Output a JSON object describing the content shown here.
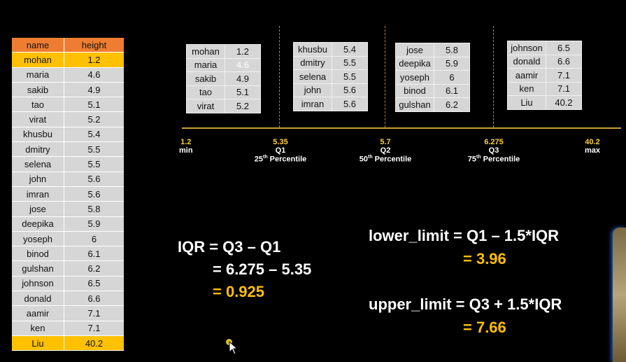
{
  "main_table": {
    "headers": [
      "name",
      "height"
    ],
    "rows": [
      [
        "mohan",
        "1.2"
      ],
      [
        "maria",
        "4.6"
      ],
      [
        "sakib",
        "4.9"
      ],
      [
        "tao",
        "5.1"
      ],
      [
        "virat",
        "5.2"
      ],
      [
        "khusbu",
        "5.4"
      ],
      [
        "dmitry",
        "5.5"
      ],
      [
        "selena",
        "5.5"
      ],
      [
        "john",
        "5.6"
      ],
      [
        "imran",
        "5.6"
      ],
      [
        "jose",
        "5.8"
      ],
      [
        "deepika",
        "5.9"
      ],
      [
        "yoseph",
        "6"
      ],
      [
        "binod",
        "6.1"
      ],
      [
        "gulshan",
        "6.2"
      ],
      [
        "johnson",
        "6.5"
      ],
      [
        "donald",
        "6.6"
      ],
      [
        "aamir",
        "7.1"
      ],
      [
        "ken",
        "7.1"
      ],
      [
        "Liu",
        "40.2"
      ]
    ]
  },
  "groups": [
    [
      [
        "mohan",
        "1.2"
      ],
      [
        "maria",
        "4.6"
      ],
      [
        "sakib",
        "4.9"
      ],
      [
        "tao",
        "5.1"
      ],
      [
        "virat",
        "5.2"
      ]
    ],
    [
      [
        "khusbu",
        "5.4"
      ],
      [
        "dmitry",
        "5.5"
      ],
      [
        "selena",
        "5.5"
      ],
      [
        "john",
        "5.6"
      ],
      [
        "imran",
        "5.6"
      ]
    ],
    [
      [
        "jose",
        "5.8"
      ],
      [
        "deepika",
        "5.9"
      ],
      [
        "yoseph",
        "6"
      ],
      [
        "binod",
        "6.1"
      ],
      [
        "gulshan",
        "6.2"
      ]
    ],
    [
      [
        "johnson",
        "6.5"
      ],
      [
        "donald",
        "6.6"
      ],
      [
        "aamir",
        "7.1"
      ],
      [
        "ken",
        "7.1"
      ],
      [
        "Liu",
        "40.2"
      ]
    ]
  ],
  "axis": {
    "min": {
      "value": "1.2",
      "label": "min"
    },
    "q1": {
      "value": "5.35",
      "label": "Q1",
      "pct_num": "25",
      "pct_sup": "th",
      "pct_text": " Percentile"
    },
    "q2": {
      "value": "5.7",
      "label": "Q2",
      "pct_num": "50",
      "pct_sup": "th",
      "pct_text": " Percentile"
    },
    "q3": {
      "value": "6.275",
      "label": "Q3",
      "pct_num": "75",
      "pct_sup": "th",
      "pct_text": " Percentile"
    },
    "max": {
      "value": "40.2",
      "label": "max"
    }
  },
  "iqr": {
    "line1": "IQR = Q3 – Q1",
    "line2": "= 6.275 – 5.35",
    "line3": "= 0.925"
  },
  "lower": {
    "formula": "lower_limit = Q1 – 1.5*IQR",
    "result": "= 3.96"
  },
  "upper": {
    "formula": "upper_limit = Q3 + 1.5*IQR",
    "result": "= 7.66"
  },
  "colors": {
    "header": "#ef7d31",
    "highlight": "#ffc000",
    "result_yellow": "#ffc000"
  }
}
